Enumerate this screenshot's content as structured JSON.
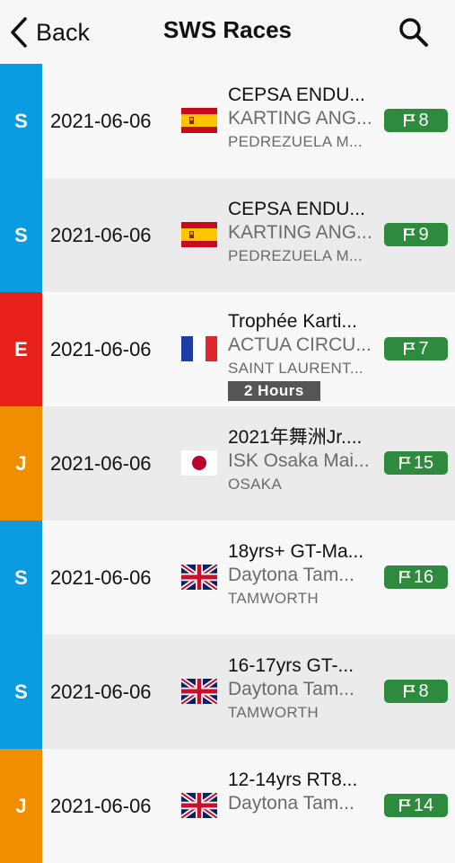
{
  "nav": {
    "back_label": "Back",
    "title": "SWS Races"
  },
  "colors": {
    "S": "#0a9be0",
    "E": "#e8201c",
    "J": "#f18d00",
    "badge": "#2e8b3e"
  },
  "races": [
    {
      "type": "S",
      "date": "2021-06-06",
      "flag": "spain",
      "name": "CEPSA ENDU...",
      "track": "KARTING ANG...",
      "city": "PEDREZUELA M...",
      "count": "8"
    },
    {
      "type": "S",
      "date": "2021-06-06",
      "flag": "spain",
      "name": "CEPSA ENDU...",
      "track": "KARTING ANG...",
      "city": "PEDREZUELA M...",
      "count": "9"
    },
    {
      "type": "E",
      "date": "2021-06-06",
      "flag": "france",
      "name": "Trophée Karti...",
      "track": "ACTUA CIRCU...",
      "city": "SAINT LAURENT...",
      "duration": "2 Hours",
      "count": "7"
    },
    {
      "type": "J",
      "date": "2021-06-06",
      "flag": "japan",
      "name": "2021年舞洲Jr....",
      "track": "ISK Osaka Mai...",
      "city": "OSAKA",
      "count": "15"
    },
    {
      "type": "S",
      "date": "2021-06-06",
      "flag": "uk",
      "name": "18yrs+ GT-Ma...",
      "track": "Daytona Tam...",
      "city": "TAMWORTH",
      "count": "16"
    },
    {
      "type": "S",
      "date": "2021-06-06",
      "flag": "uk",
      "name": "16-17yrs GT-...",
      "track": "Daytona Tam...",
      "city": "TAMWORTH",
      "count": "8"
    },
    {
      "type": "J",
      "date": "2021-06-06",
      "flag": "uk",
      "name": "12-14yrs RT8...",
      "track": "Daytona Tam...",
      "city": "",
      "count": "14"
    }
  ]
}
